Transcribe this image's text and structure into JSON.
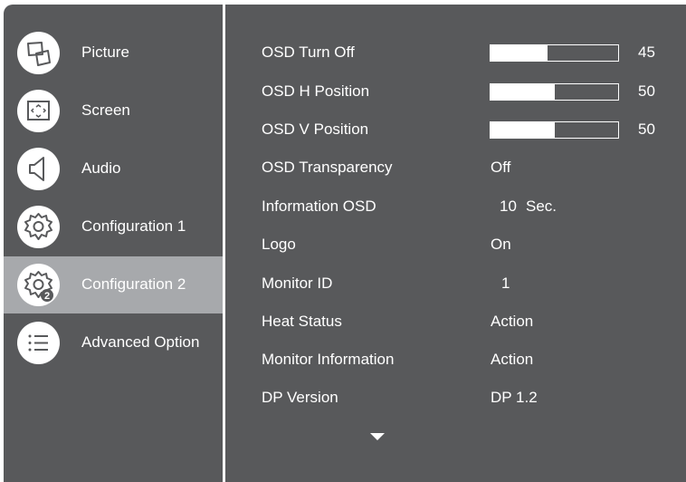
{
  "sidebar": {
    "items": [
      {
        "label": "Picture",
        "icon": "picture-icon",
        "selected": false
      },
      {
        "label": "Screen",
        "icon": "screen-icon",
        "selected": false
      },
      {
        "label": "Audio",
        "icon": "audio-icon",
        "selected": false
      },
      {
        "label": "Configuration 1",
        "icon": "gear-icon",
        "selected": false
      },
      {
        "label": "Configuration 2",
        "icon": "gear-2-icon",
        "icon_badge": "2",
        "selected": true
      },
      {
        "label": "Advanced Option",
        "icon": "list-icon",
        "selected": false
      }
    ]
  },
  "settings": {
    "osd_turn_off": {
      "label": "OSD Turn Off",
      "value": "45",
      "level": 45,
      "max": 100
    },
    "osd_h_position": {
      "label": "OSD H Position",
      "value": "50",
      "level": 50,
      "max": 100
    },
    "osd_v_position": {
      "label": "OSD V Position",
      "value": "50",
      "level": 50,
      "max": 100
    },
    "osd_transparency": {
      "label": "OSD Transparency",
      "value": "Off"
    },
    "information_osd": {
      "label": "Information OSD",
      "value": "10",
      "unit": "Sec."
    },
    "logo": {
      "label": "Logo",
      "value": "On"
    },
    "monitor_id": {
      "label": "Monitor ID",
      "value": "1"
    },
    "heat_status": {
      "label": "Heat Status",
      "value": "Action"
    },
    "monitor_information": {
      "label": "Monitor Information",
      "value": "Action"
    },
    "dp_version": {
      "label": "DP Version",
      "value": "DP 1.2"
    }
  },
  "scroll_indicator": {
    "icon": "triangle-down-icon"
  },
  "colors": {
    "panel_background": "#58595b",
    "selected_background": "#a7a9ac",
    "text": "#ffffff",
    "icon_background": "#ffffff",
    "icon_stroke": "#58595b"
  }
}
